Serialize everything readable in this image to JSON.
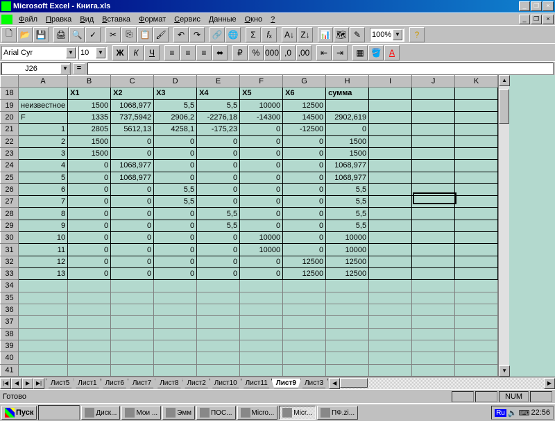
{
  "title": "Microsoft Excel - Книга.xls",
  "menu": [
    "Файл",
    "Правка",
    "Вид",
    "Вставка",
    "Формат",
    "Сервис",
    "Данные",
    "Окно",
    "?"
  ],
  "font": {
    "name": "Arial Cyr",
    "size": "10"
  },
  "zoom": "100%",
  "namebox": "J26",
  "columns": [
    "A",
    "B",
    "C",
    "D",
    "E",
    "F",
    "G",
    "H",
    "I",
    "J",
    "K"
  ],
  "row_start": 18,
  "row_end": 41,
  "data_rows": [
    {
      "A": "",
      "B": "X1",
      "C": "X2",
      "D": "X3",
      "E": "X4",
      "F": "X5",
      "G": "X6",
      "H": "сумма"
    },
    {
      "A": "неизвестное",
      "B": "1500",
      "C": "1068,977",
      "D": "5,5",
      "E": "5,5",
      "F": "10000",
      "G": "12500",
      "H": ""
    },
    {
      "A": "F",
      "B": "1335",
      "C": "737,5942",
      "D": "2906,2",
      "E": "-2276,18",
      "F": "-14300",
      "G": "14500",
      "H": "2902,619"
    },
    {
      "A": "1",
      "B": "2805",
      "C": "5612,13",
      "D": "4258,1",
      "E": "-175,23",
      "F": "0",
      "G": "-12500",
      "H": "0"
    },
    {
      "A": "2",
      "B": "1500",
      "C": "0",
      "D": "0",
      "E": "0",
      "F": "0",
      "G": "0",
      "H": "1500"
    },
    {
      "A": "3",
      "B": "1500",
      "C": "0",
      "D": "0",
      "E": "0",
      "F": "0",
      "G": "0",
      "H": "1500"
    },
    {
      "A": "4",
      "B": "0",
      "C": "1068,977",
      "D": "0",
      "E": "0",
      "F": "0",
      "G": "0",
      "H": "1068,977"
    },
    {
      "A": "5",
      "B": "0",
      "C": "1068,977",
      "D": "0",
      "E": "0",
      "F": "0",
      "G": "0",
      "H": "1068,977"
    },
    {
      "A": "6",
      "B": "0",
      "C": "0",
      "D": "5,5",
      "E": "0",
      "F": "0",
      "G": "0",
      "H": "5,5"
    },
    {
      "A": "7",
      "B": "0",
      "C": "0",
      "D": "5,5",
      "E": "0",
      "F": "0",
      "G": "0",
      "H": "5,5"
    },
    {
      "A": "8",
      "B": "0",
      "C": "0",
      "D": "0",
      "E": "5,5",
      "F": "0",
      "G": "0",
      "H": "5,5"
    },
    {
      "A": "9",
      "B": "0",
      "C": "0",
      "D": "0",
      "E": "5,5",
      "F": "0",
      "G": "0",
      "H": "5,5"
    },
    {
      "A": "10",
      "B": "0",
      "C": "0",
      "D": "0",
      "E": "0",
      "F": "10000",
      "G": "0",
      "H": "10000"
    },
    {
      "A": "11",
      "B": "0",
      "C": "0",
      "D": "0",
      "E": "0",
      "F": "10000",
      "G": "0",
      "H": "10000"
    },
    {
      "A": "12",
      "B": "0",
      "C": "0",
      "D": "0",
      "E": "0",
      "F": "0",
      "G": "12500",
      "H": "12500"
    },
    {
      "A": "13",
      "B": "0",
      "C": "0",
      "D": "0",
      "E": "0",
      "F": "0",
      "G": "12500",
      "H": "12500"
    }
  ],
  "sheet_tabs": [
    "Лист5",
    "Лист1",
    "Лист6",
    "Лист7",
    "Лист8",
    "Лист2",
    "Лист10",
    "Лист11",
    "Лист9",
    "Лист3"
  ],
  "active_tab": "Лист9",
  "status": {
    "ready": "Готово",
    "num": "NUM"
  },
  "taskbar": {
    "start": "Пуск",
    "buttons": [
      "Диск...",
      "Мои ...",
      "Эмм",
      "ПОС...",
      "Micro...",
      "Micr...",
      "ПФ.zi..."
    ],
    "active_index": 5,
    "lang": "Ru",
    "clock": "22:56"
  },
  "active_cell": {
    "col": "J",
    "row": 26
  }
}
